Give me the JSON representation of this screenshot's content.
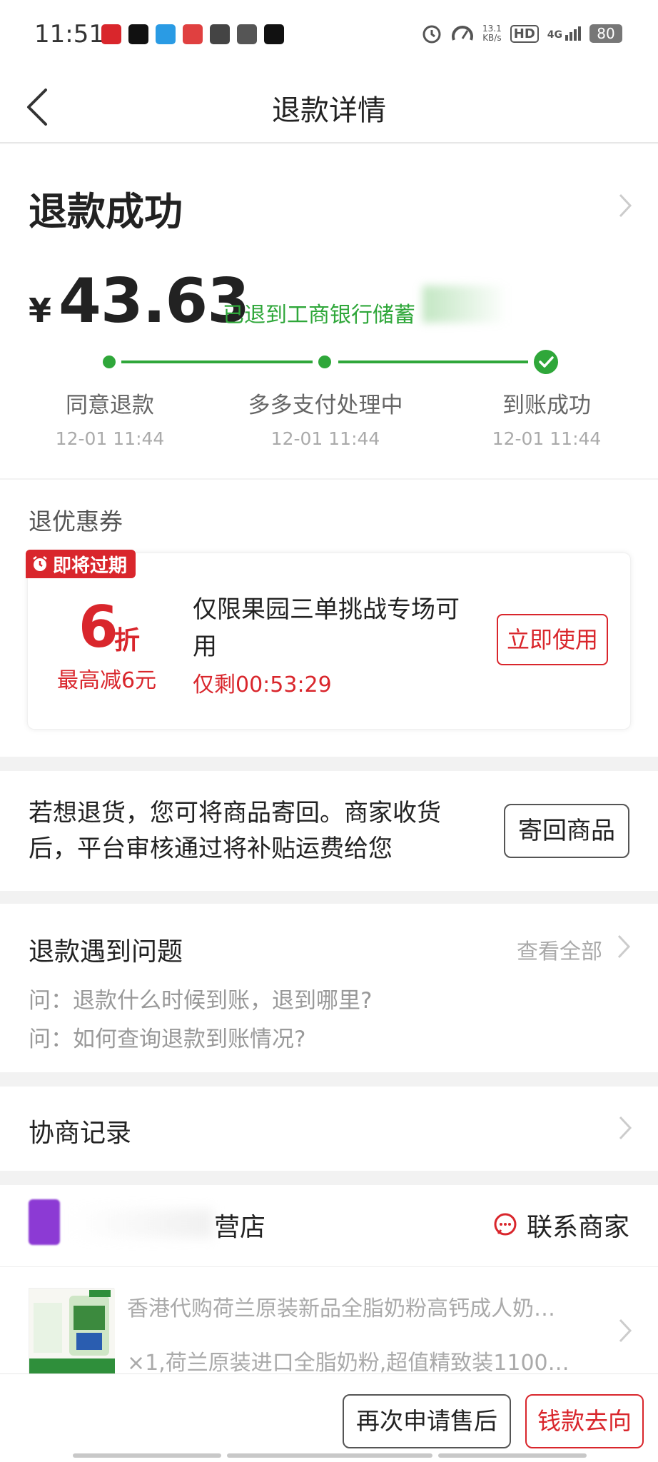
{
  "status_bar": {
    "time": "11:51",
    "net_speed": "13.1",
    "net_unit": "KB/s",
    "hd": "HD",
    "signal": "4G",
    "battery": "80"
  },
  "header": {
    "title": "退款详情"
  },
  "refund": {
    "status": "退款成功",
    "currency": "¥",
    "amount": "43.63",
    "destination": "已退到工商银行储蓄",
    "steps": [
      {
        "label": "同意退款",
        "time": "12-01 11:44"
      },
      {
        "label": "多多支付处理中",
        "time": "12-01 11:44"
      },
      {
        "label": "到账成功",
        "time": "12-01 11:44"
      }
    ]
  },
  "coupon": {
    "section_label": "退优惠券",
    "expire_tag": "即将过期",
    "discount": "6",
    "discount_unit": "折",
    "max_reduction": "最高减6元",
    "description": "仅限果园三单挑战专场可用",
    "countdown": "仅剩00:53:29",
    "use_button": "立即使用"
  },
  "return_goods": {
    "text": "若想退货，您可将商品寄回。商家收货后，平台审核通过将补贴运费给您",
    "button": "寄回商品"
  },
  "faq": {
    "title": "退款遇到问题",
    "view_all": "查看全部",
    "questions": [
      "问：退款什么时候到账，退到哪里?",
      "问：如何查询退款到账情况?"
    ]
  },
  "record": {
    "title": "协商记录"
  },
  "store": {
    "name": "营店",
    "contact": "联系商家",
    "product_name": "香港代购荷兰原装新品全脂奶粉高钙成人奶…",
    "product_spec": "×1,荷兰原装进口全脂奶粉,超值精致装1100…"
  },
  "bottom": {
    "reapply": "再次申请售后",
    "money_flow": "钱款去向"
  },
  "colors": {
    "accent_red": "#d9262c",
    "success_green": "#2fa73a"
  }
}
